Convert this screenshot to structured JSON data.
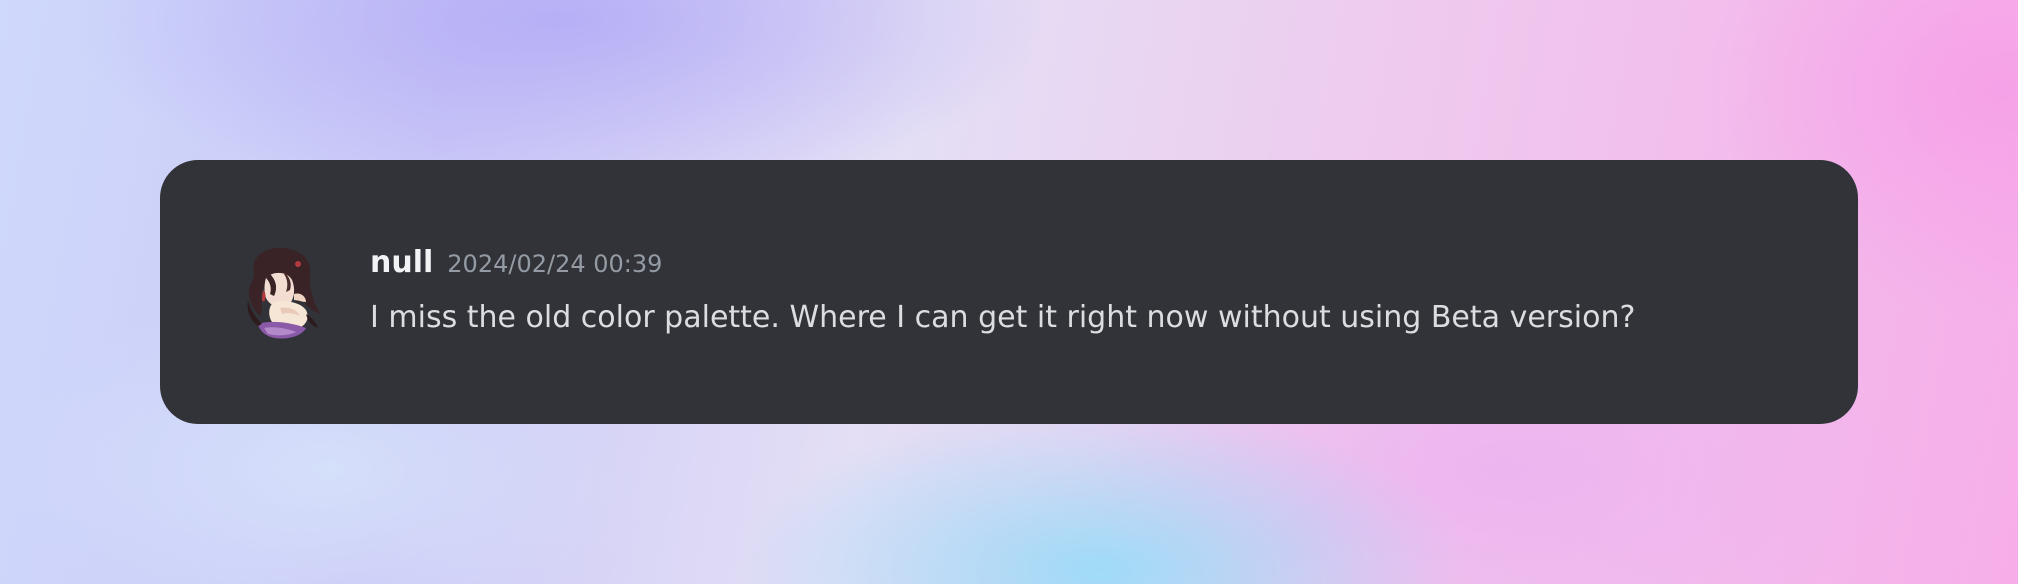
{
  "message": {
    "author": "null",
    "timestamp": "2024/02/24 00:39",
    "content": "I miss the old color palette. Where I can get it right now without using Beta version?",
    "avatar_icon": "anime-character-avatar-icon"
  },
  "colors": {
    "card_background": "#313338",
    "username": "#f2f3f5",
    "timestamp": "#949ba4",
    "message_text": "#dbdee1"
  }
}
